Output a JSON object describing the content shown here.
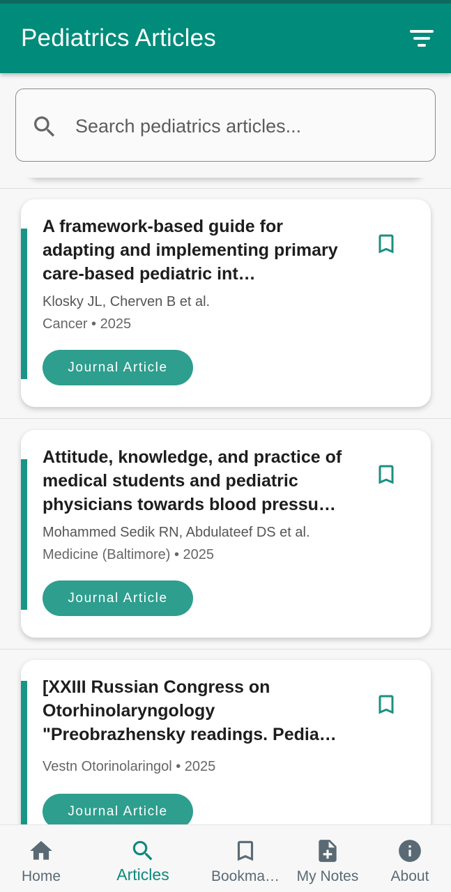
{
  "appbar": {
    "title": "Pediatrics Articles",
    "filter_icon": "filter-list-icon"
  },
  "search": {
    "placeholder": "Search pediatrics articles..."
  },
  "articles": [
    {
      "title": "A framework-based guide for adapting and implementing primary care-based pediatric int…",
      "authors": "Klosky JL, Cherven B et al.",
      "journal_line": "Cancer • 2025",
      "type_label": "Journal Article"
    },
    {
      "title": "Attitude, knowledge, and practice of medical students and pediatric physicians towards blood pressu…",
      "authors": "Mohammed Sedik RN, Abdulateef DS et al.",
      "journal_line": "Medicine (Baltimore) • 2025",
      "type_label": "Journal Article"
    },
    {
      "title": "[XXIII Russian Congress on Otorhinolaryngology \"Preobrazhensky readings. Pedia…",
      "authors": "",
      "journal_line": "Vestn Otorinolaringol • 2025",
      "type_label": "Journal Article"
    }
  ],
  "nav": [
    {
      "label": "Home",
      "icon": "home-icon"
    },
    {
      "label": "Articles",
      "icon": "search-icon",
      "active": true
    },
    {
      "label": "Bookma…",
      "icon": "bookmark-icon"
    },
    {
      "label": "My Notes",
      "icon": "note-add-icon"
    },
    {
      "label": "About",
      "icon": "info-icon"
    }
  ],
  "colors": {
    "primary": "#008b7a",
    "accent": "#1a9486",
    "chip": "#2e9e8e",
    "nav_inactive": "#5a6a74"
  }
}
